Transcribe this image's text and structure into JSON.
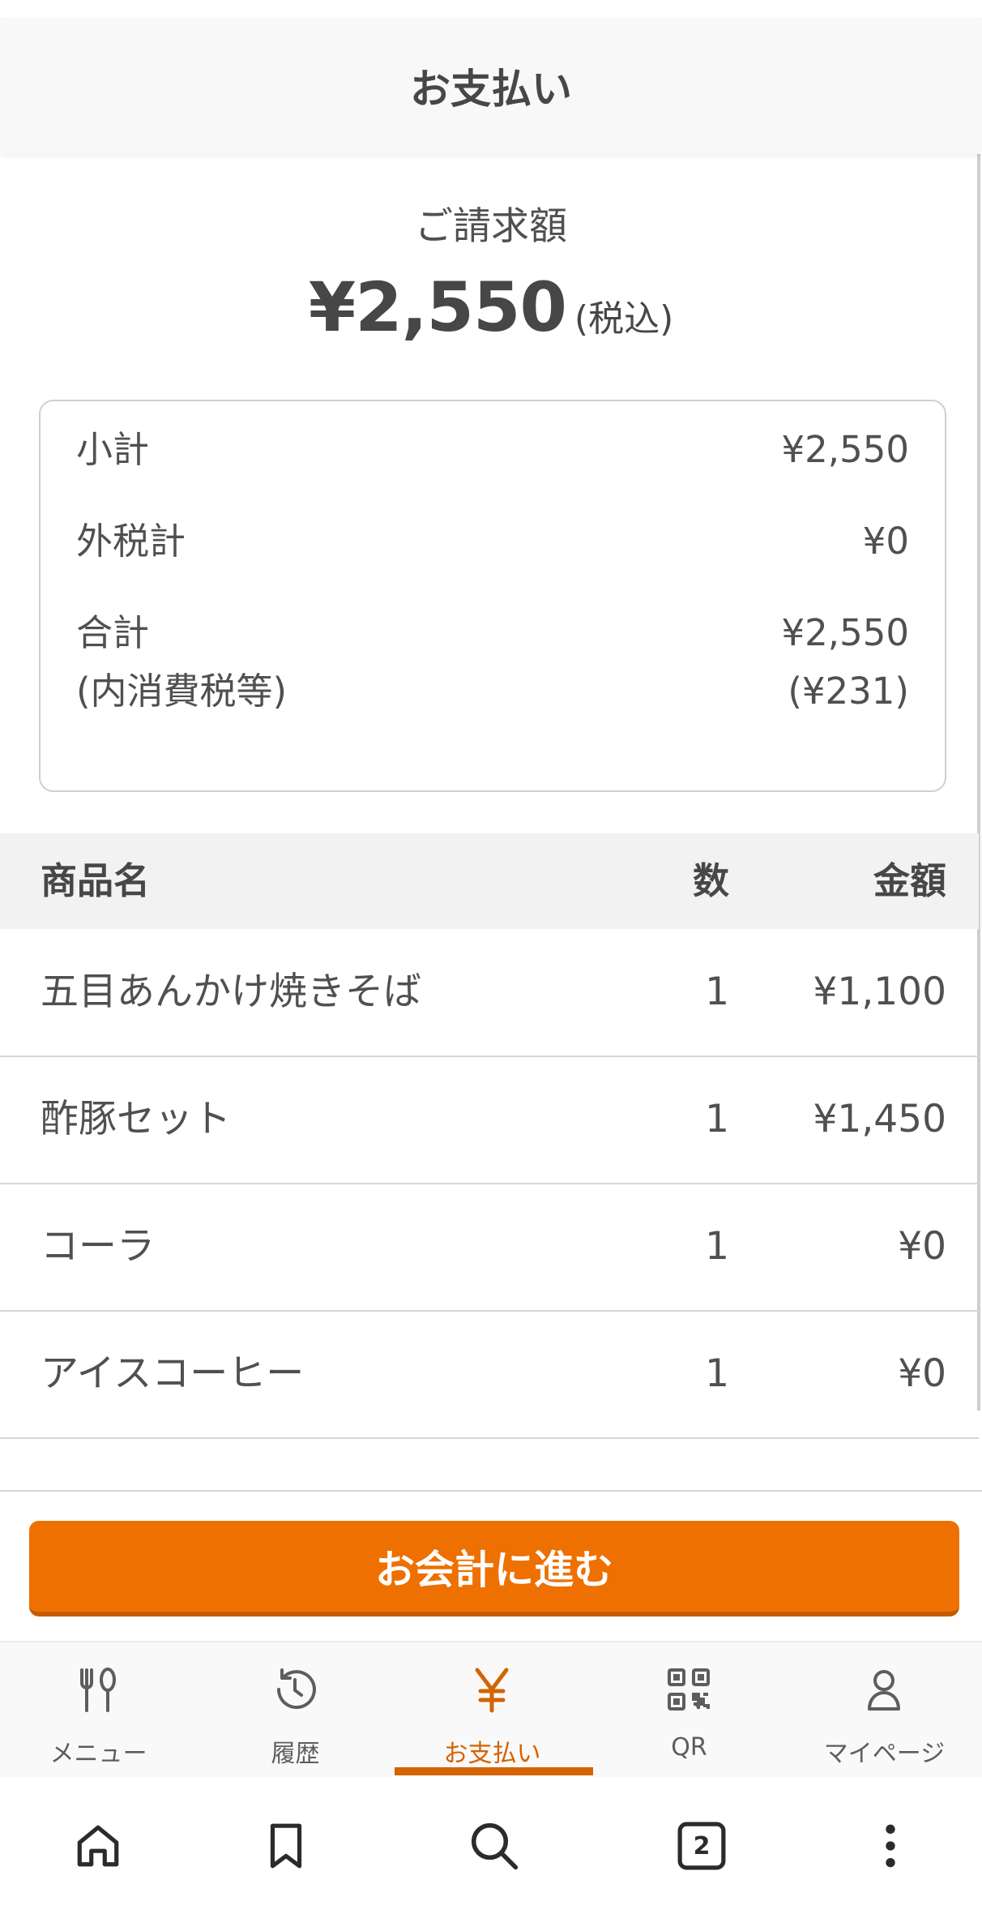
{
  "header": {
    "title": "お支払い"
  },
  "billing": {
    "label": "ご請求額",
    "amount": "¥2,550",
    "tax_note": "(税込)"
  },
  "summary": {
    "subtotal_label": "小計",
    "subtotal_value": "¥2,550",
    "external_tax_label": "外税計",
    "external_tax_value": "¥0",
    "total_label": "合計",
    "total_value": "¥2,550",
    "included_tax_label": "(内消費税等)",
    "included_tax_value": "(¥231)"
  },
  "table": {
    "headers": {
      "name": "商品名",
      "qty": "数",
      "price": "金額"
    },
    "rows": [
      {
        "name": "五目あんかけ焼きそば",
        "qty": "1",
        "price": "¥1,100"
      },
      {
        "name": "酢豚セット",
        "qty": "1",
        "price": "¥1,450"
      },
      {
        "name": "コーラ",
        "qty": "1",
        "price": "¥0"
      },
      {
        "name": "アイスコーヒー",
        "qty": "1",
        "price": "¥0"
      }
    ]
  },
  "checkout": {
    "label": "お会計に進む"
  },
  "nav": {
    "items": [
      {
        "label": "メニュー",
        "icon": "fork-spoon-icon"
      },
      {
        "label": "履歴",
        "icon": "history-icon"
      },
      {
        "label": "お支払い",
        "icon": "yen-icon"
      },
      {
        "label": "QR",
        "icon": "qr-code-icon"
      },
      {
        "label": "マイページ",
        "icon": "person-icon"
      }
    ],
    "active_index": 2
  },
  "browser": {
    "tab_count": "2"
  },
  "colors": {
    "accent": "#ee7000",
    "active": "#d46300",
    "text": "#505050"
  }
}
